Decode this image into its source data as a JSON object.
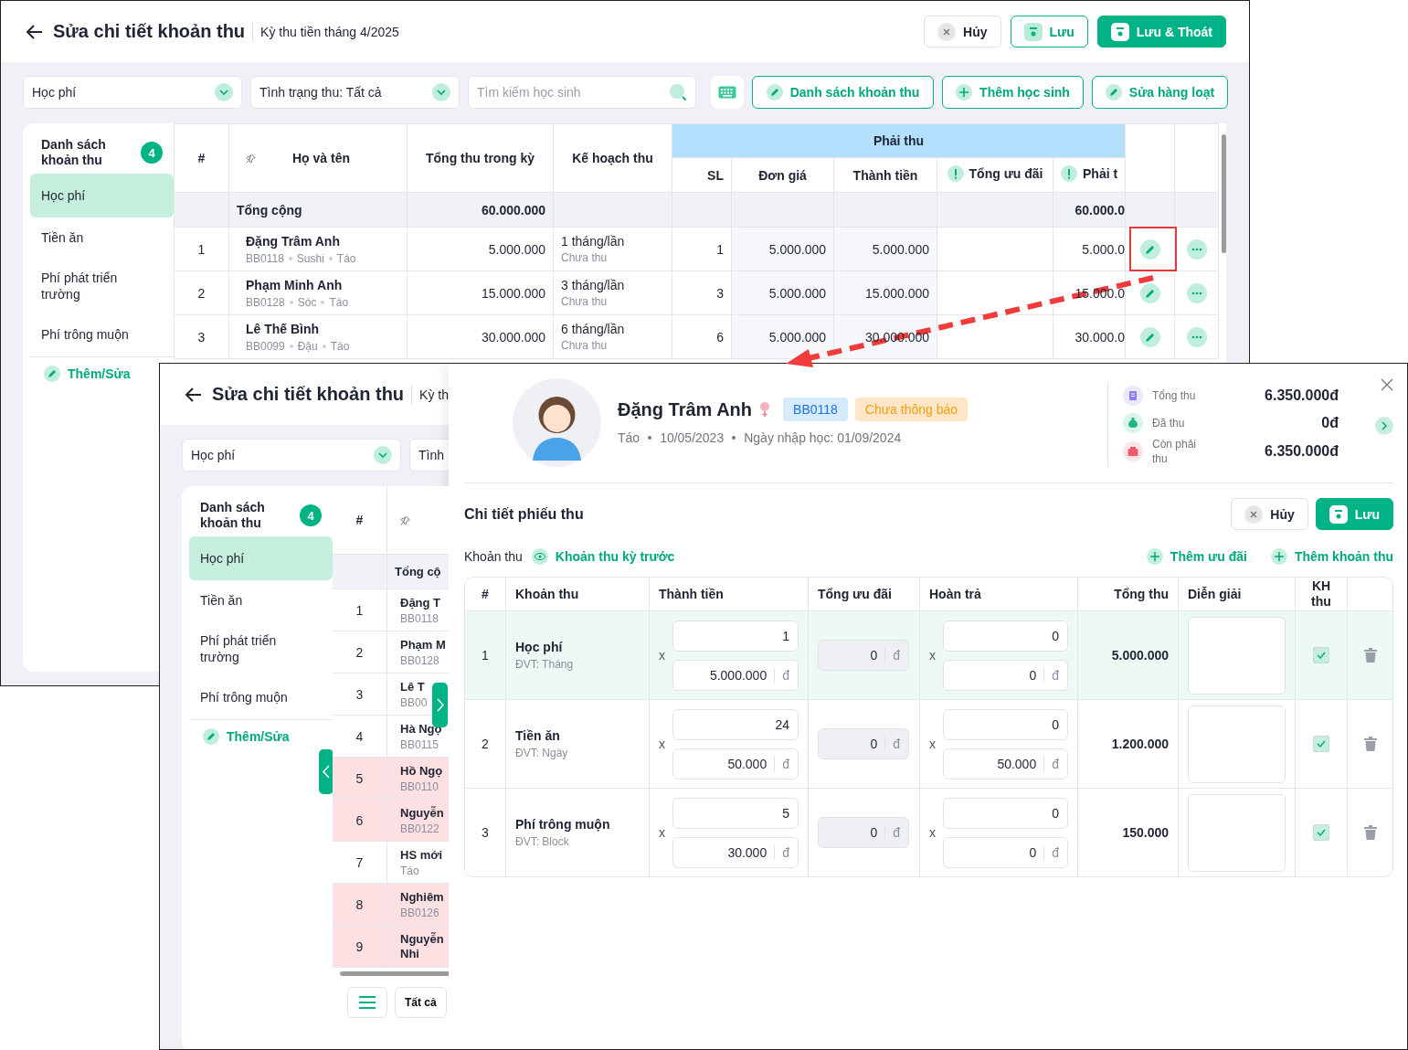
{
  "back_window": {
    "title": "Sửa chi tiết khoản thu",
    "period": "Kỳ thu tiền tháng 4/2025",
    "actions": [
      {
        "label": "Hủy",
        "kind": "cancel"
      },
      {
        "label": "Lưu",
        "kind": "save"
      },
      {
        "label": "Lưu & Thoát",
        "kind": "primary"
      }
    ],
    "fee_select": "Học phí",
    "status_select": "Tình trạng thu: Tất cả",
    "search": {
      "placeholder": "Tìm kiếm học sinh"
    },
    "tools": [
      {
        "label": "Danh sách khoản thu",
        "kind": "edit"
      },
      {
        "label": "Thêm học sinh",
        "kind": "add"
      },
      {
        "label": "Sửa hàng loạt",
        "kind": "edit"
      }
    ],
    "sidebar": {
      "title": "Danh sách khoản thu",
      "count": "4",
      "items": [
        {
          "label": "Học phí",
          "selected": true
        },
        {
          "label": "Tiền ăn",
          "selected": false
        },
        {
          "label": "Phí phát triển trường",
          "selected": false
        },
        {
          "label": "Phí trông muộn",
          "selected": false
        }
      ],
      "edit_link": "Thêm/Sửa"
    },
    "table": {
      "columns": [
        "#",
        "Họ và tên",
        "Tổng thu trong kỳ",
        "Kế hoạch thu"
      ],
      "group": "Phải thu",
      "group_columns": [
        {
          "label": "SL",
          "warn": false
        },
        {
          "label": "Đơn giá",
          "warn": false
        },
        {
          "label": "Thành tiền",
          "warn": false
        },
        {
          "label": "Tổng ưu đãi",
          "warn": true
        },
        {
          "label": "Phải t",
          "warn": true
        }
      ],
      "total": {
        "label": "Tổng cộng",
        "amount": "60.000.000",
        "due": "60.000.0"
      },
      "rows": [
        {
          "index": "1",
          "name": "Đặng Trâm Anh",
          "meta": [
            "BB0118",
            "Sushi",
            "Táo"
          ],
          "total": "5.000.000",
          "plan": "1 tháng/lần",
          "status": "Chưa thu",
          "qty": "1",
          "price": "5.000.000",
          "amount": "5.000.000",
          "due": "5.000.0"
        },
        {
          "index": "2",
          "name": "Phạm Minh Anh",
          "meta": [
            "BB0128",
            "Sóc",
            "Táo"
          ],
          "total": "15.000.000",
          "plan": "3 tháng/lần",
          "status": "Chưa thu",
          "qty": "3",
          "price": "5.000.000",
          "amount": "15.000.000",
          "due": "15.000.0"
        },
        {
          "index": "3",
          "name": "Lê Thế Bình",
          "meta": [
            "BB0099",
            "Đậu",
            "Táo"
          ],
          "total": "30.000.000",
          "plan": "6 tháng/lần",
          "status": "Chưa thu",
          "qty": "6",
          "price": "5.000.000",
          "amount": "30.000.000",
          "due": "30.000.0"
        }
      ]
    }
  },
  "front_window": {
    "title": "Sửa chi tiết khoản thu",
    "period": "Kỳ th",
    "fee_select": "Học phí",
    "status_select": "Tình",
    "sidebar": {
      "title": "Danh sách khoản thu",
      "count": "4",
      "items": [
        {
          "label": "Học phí",
          "selected": true
        },
        {
          "label": "Tiền ăn",
          "selected": false
        },
        {
          "label": "Phí phát triển trường",
          "selected": false
        },
        {
          "label": "Phí trông muộn",
          "selected": false
        }
      ],
      "edit_link": "Thêm/Sửa"
    },
    "table": {
      "column": "#",
      "total_label": "Tổng cộ",
      "rows": [
        {
          "index": "1",
          "name": "Đặng T",
          "sub": "BB0118",
          "flagged": false
        },
        {
          "index": "2",
          "name": "Phạm M",
          "sub": "BB0128",
          "flagged": false
        },
        {
          "index": "3",
          "name": "Lê T",
          "sub": "BB00",
          "flagged": false
        },
        {
          "index": "4",
          "name": "Hà Ngọ",
          "sub": "BB0115",
          "flagged": false
        },
        {
          "index": "5",
          "name": "Hồ Ngọ",
          "sub": "BB0110",
          "flagged": true
        },
        {
          "index": "6",
          "name": "Nguyễn",
          "sub": "BB0122",
          "flagged": true
        },
        {
          "index": "7",
          "name": "HS mới",
          "sub": "Táo",
          "flagged": false
        },
        {
          "index": "8",
          "name": "Nghiêm",
          "sub": "BB0126",
          "flagged": true
        },
        {
          "index": "9",
          "name": "Nguyễn Nhi",
          "flagged": true
        }
      ]
    },
    "filter_button": "Tất cả"
  },
  "student_panel": {
    "name": "Đặng Trâm Anh",
    "code": "BB0118",
    "notice": "Chưa thông báo",
    "meta": [
      "Táo",
      "10/05/2023",
      "Ngày nhập học: 01/09/2024"
    ],
    "summary": [
      {
        "label": "Tổng thu",
        "value": "6.350.000đ",
        "kind": "total"
      },
      {
        "label": "Đã thu",
        "value": "0đ",
        "kind": "paid"
      },
      {
        "label": "Còn phải thu",
        "value": "6.350.000đ",
        "kind": "remaining"
      }
    ],
    "section_title": "Chi tiết phiếu thu",
    "actions": [
      {
        "label": "Hủy",
        "kind": "cancel"
      },
      {
        "label": "Lưu",
        "kind": "primary"
      }
    ],
    "fees_label": "Khoản thu",
    "previous_link": "Khoản thu kỳ trước",
    "add_links": [
      "Thêm ưu đãi",
      "Thêm khoản thu"
    ],
    "table": {
      "columns": [
        "#",
        "Khoản thu",
        "Thành tiền",
        "Tổng ưu đãi",
        "Hoàn trả",
        "Tổng thu",
        "Diễn giải",
        "KH thu"
      ],
      "rows": [
        {
          "index": "1",
          "name": "Học phí",
          "unit": "ĐVT: Tháng",
          "qty_sign": "x",
          "qty": "1",
          "price": "5.000.000",
          "price_unit": "đ",
          "discount": "0",
          "discount_unit": "đ",
          "refund_sign": "x",
          "refund_qty": "0",
          "refund_amount": "0",
          "refund_unit": "đ",
          "total": "5.000.000",
          "planned": true,
          "selected": true
        },
        {
          "index": "2",
          "name": "Tiền ăn",
          "unit": "ĐVT: Ngày",
          "qty_sign": "x",
          "qty": "24",
          "price": "50.000",
          "price_unit": "đ",
          "discount": "0",
          "discount_unit": "đ",
          "refund_sign": "x",
          "refund_qty": "0",
          "refund_amount": "50.000",
          "refund_unit": "đ",
          "total": "1.200.000",
          "planned": true,
          "selected": false
        },
        {
          "index": "3",
          "name": "Phí trông muộn",
          "unit": "ĐVT: Block",
          "qty_sign": "x",
          "qty": "5",
          "price": "30.000",
          "price_unit": "đ",
          "discount": "0",
          "discount_unit": "đ",
          "refund_sign": "x",
          "refund_qty": "0",
          "refund_amount": "0",
          "refund_unit": "đ",
          "total": "150.000",
          "planned": true,
          "selected": false
        }
      ]
    }
  }
}
